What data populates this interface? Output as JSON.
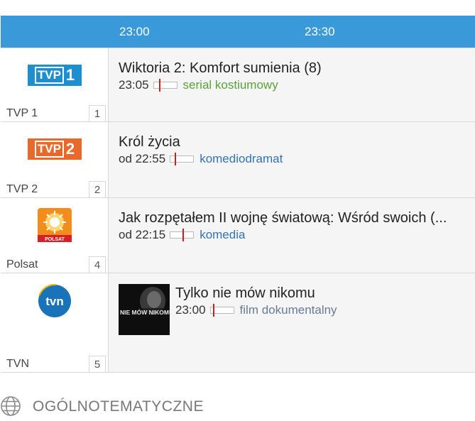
{
  "timeline": {
    "times": [
      "23:00",
      "23:30"
    ]
  },
  "channels": [
    {
      "name": "TVP 1",
      "number": "1",
      "logo_text": "TVP",
      "logo_digit": "1",
      "logo_color": "#1d8fd0",
      "title": "Wiktoria 2: Komfort sumienia (8)",
      "time": "23:05",
      "genre": "serial kostiumowy",
      "progress": 0.26
    },
    {
      "name": "TVP 2",
      "number": "2",
      "logo_text": "TVP",
      "logo_digit": "2",
      "logo_color": "#e8692a",
      "title": "Król życia",
      "time": "od 22:55",
      "genre": "komediodramat",
      "progress": 0.2
    },
    {
      "name": "Polsat",
      "number": "4",
      "logo_text": "POLSAT",
      "title": "Jak rozpętałem II wojnę światową: Wśród swoich (...",
      "time": "od 22:15",
      "genre": "komedia",
      "progress": 0.55
    },
    {
      "name": "TVN",
      "number": "5",
      "logo_text": "tvn",
      "logo_color": "#1a73b8",
      "title": "Tylko nie mów nikomu",
      "thumb_text": "NIE MÓW NIKOMU",
      "time": "23:00",
      "genre": "film dokumentalny",
      "progress": 0.12
    }
  ],
  "footer": {
    "category": "OGÓLNOTEMATYCZNE",
    "icon": "globe-icon"
  }
}
